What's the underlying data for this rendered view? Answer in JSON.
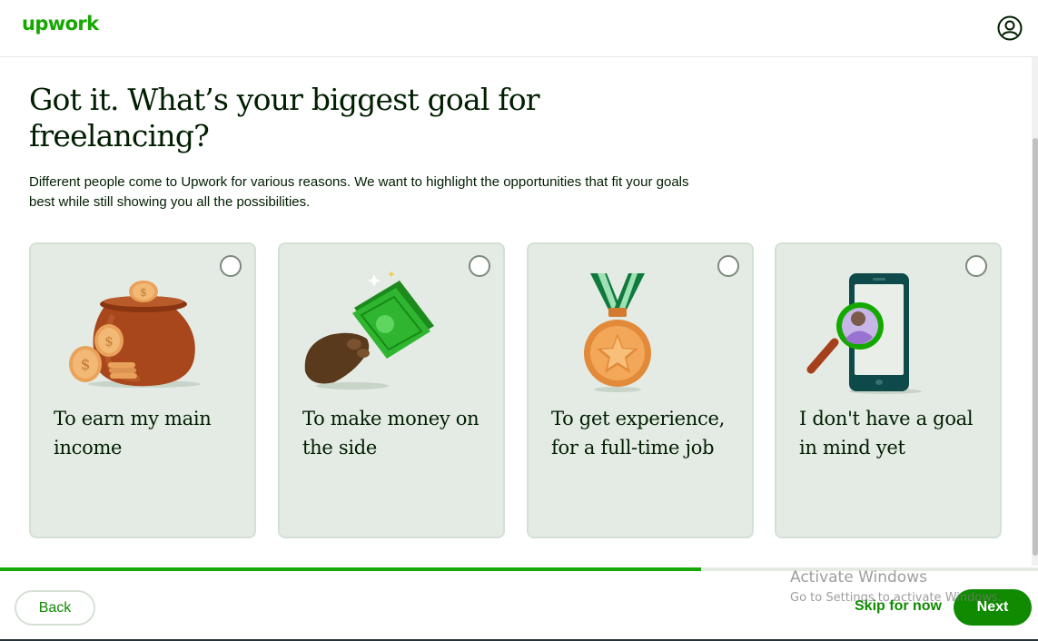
{
  "header": {
    "logo": "upwork",
    "account_icon": "account-circle-icon"
  },
  "main": {
    "title": "Got it. What’s your biggest goal for freelancing?",
    "subtitle": "Different people come to Upwork for various reasons. We want to highlight the opportunities that fit your goals best while still showing you all the possibilities.",
    "options": [
      {
        "label": "To earn my main income",
        "icon": "money-bag-icon",
        "selected": false
      },
      {
        "label": "To make money on the side",
        "icon": "cash-in-hand-icon",
        "selected": false
      },
      {
        "label": "To get experience, for a full-time job",
        "icon": "medal-icon",
        "selected": false
      },
      {
        "label": "I don't have a goal in mind yet",
        "icon": "phone-search-icon",
        "selected": false
      }
    ]
  },
  "progress": {
    "value": 0.675
  },
  "footer": {
    "back_label": "Back",
    "skip_label": "Skip for now",
    "next_label": "Next"
  },
  "watermark": {
    "line1": "Activate Windows",
    "line2": "Go to Settings to activate Windows."
  },
  "colors": {
    "brand_green": "#14a800",
    "button_green": "#108a00",
    "card_bg": "#e4ebe4",
    "text": "#001e00"
  }
}
